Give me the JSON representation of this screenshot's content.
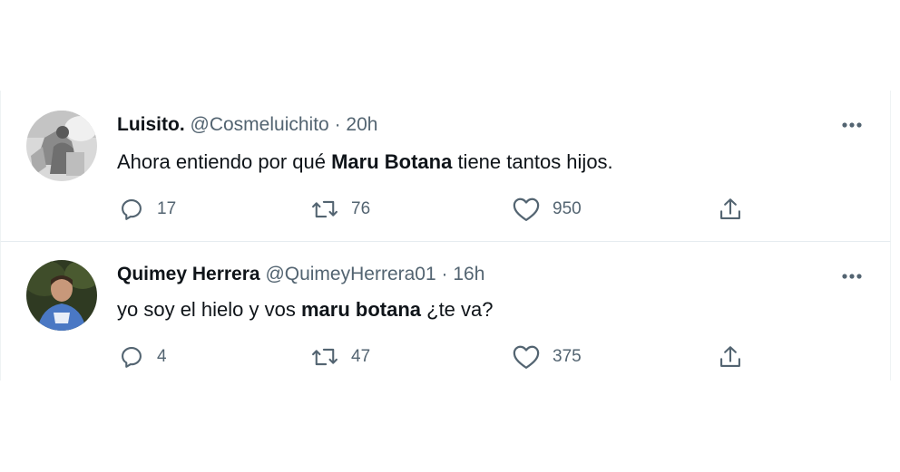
{
  "tweets": [
    {
      "display_name": "Luisito.",
      "handle": "@Cosmeluichito",
      "separator": "·",
      "time": "20h",
      "text_before": "Ahora entiendo por qué ",
      "text_bold": "Maru Botana",
      "text_after": " tiene tantos hijos.",
      "replies": "17",
      "retweets": "76",
      "likes": "950",
      "avatar_icon": "avatar-photo-light"
    },
    {
      "display_name": "Quimey Herrera",
      "handle": "@QuimeyHerrera01",
      "separator": "·",
      "time": "16h",
      "text_before": "yo soy el hielo y vos ",
      "text_bold": "maru botana",
      "text_after": " ¿te va?",
      "replies": "4",
      "retweets": "47",
      "likes": "375",
      "avatar_icon": "avatar-photo-dark"
    }
  ],
  "icons": {
    "reply": "reply-icon",
    "retweet": "retweet-icon",
    "like": "like-icon",
    "share": "share-icon",
    "more": "more-icon"
  },
  "colors": {
    "text": "#0f1419",
    "secondary": "#536471",
    "divider": "#e6ecf0"
  }
}
